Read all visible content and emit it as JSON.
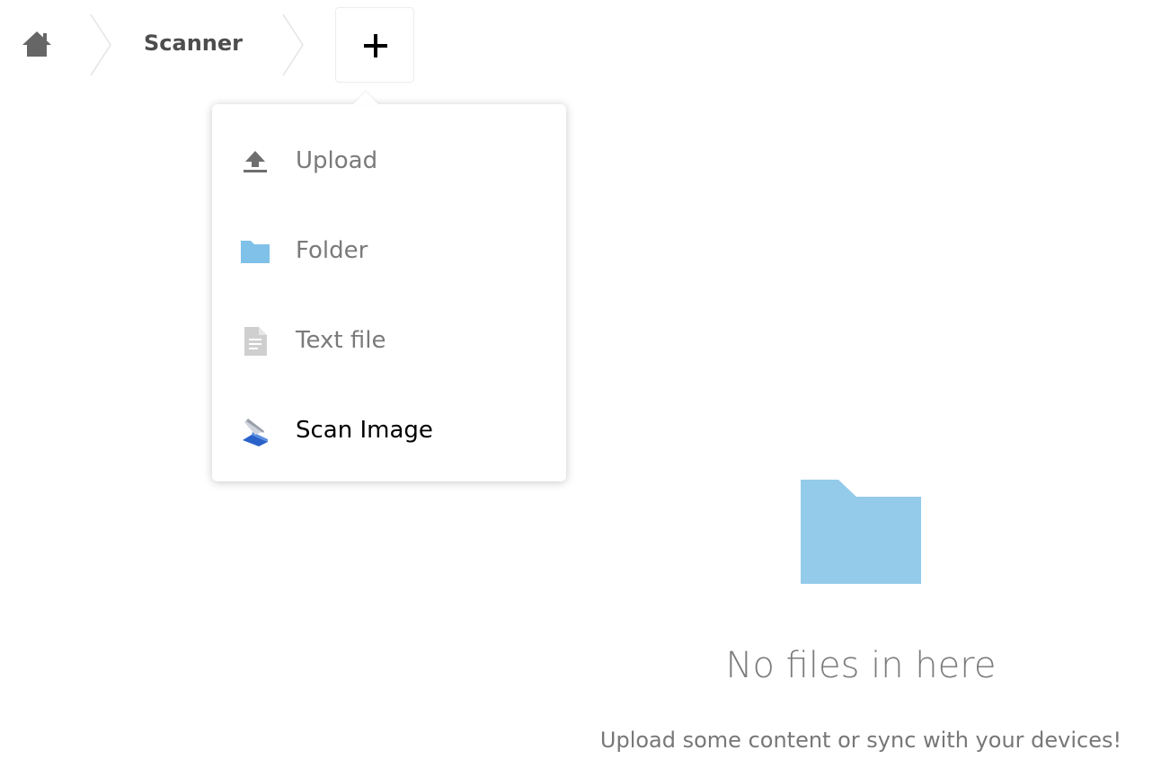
{
  "breadcrumb": {
    "home_icon": "home-icon",
    "items": [
      {
        "label": "Scanner"
      }
    ],
    "add_button_icon": "plus-icon"
  },
  "new_menu": {
    "items": [
      {
        "label": "Upload",
        "icon": "upload-icon"
      },
      {
        "label": "Folder",
        "icon": "folder-icon"
      },
      {
        "label": "Text file",
        "icon": "text-file-icon"
      },
      {
        "label": "Scan Image",
        "icon": "scanner-icon"
      }
    ]
  },
  "empty_content": {
    "icon": "folder-icon",
    "title": "No files in here",
    "message": "Upload some content or sync with your devices!"
  },
  "colors": {
    "folder_blue": "#94cbea",
    "text_gray": "#7a7a7a",
    "breadcrumb_text": "#4d4d4d"
  }
}
